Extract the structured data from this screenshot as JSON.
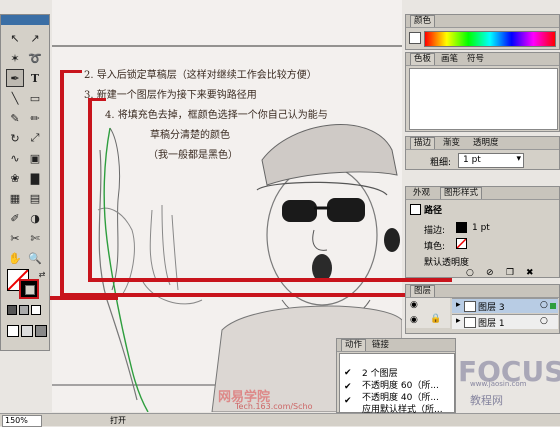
{
  "annotations": {
    "step2": "2. 导入后锁定草稿层（这样对继续工作会比较方便）",
    "step3": "3. 新建一个图层作为接下来要钩路径用",
    "step4_line1": "4. 将填充色去掉，框颜色选择一个你自己认为能与",
    "step4_line2": "草稿分清楚的颜色",
    "step4_line3": "（我一般都是黑色）"
  },
  "color_palette": {
    "title": "颜色"
  },
  "swatch_tabs": [
    "色板",
    "画笔",
    "符号"
  ],
  "stroke_tabs": [
    "描边",
    "渐变",
    "透明度"
  ],
  "stroke": {
    "weight_label": "粗细:",
    "weight_value": "1 pt"
  },
  "appearance_tabs": [
    "外观",
    "图形样式"
  ],
  "appearance": {
    "object": "路径",
    "stroke_label": "描边:",
    "stroke_value": "1 pt",
    "fill_label": "填色:",
    "opacity_label": "默认透明度"
  },
  "layers": {
    "tab": "图层",
    "rows": [
      {
        "name": "图层 3",
        "selected": true
      },
      {
        "name": "图层 1",
        "selected": false
      }
    ]
  },
  "actions": {
    "tabs": [
      "动作",
      "链接"
    ],
    "count_label": "2 个图层",
    "items": [
      "不透明度 60（所...",
      "不透明度 40（所...",
      "应用默认样式（所..."
    ]
  },
  "status": {
    "zoom": "150%",
    "label": "打开"
  },
  "watermarks": {
    "site_cn": "网易学院",
    "site_url": "Tech.163.com/Scho",
    "brand": "FOCUS",
    "site2_cn": "教程网",
    "site2_url": "www.jaosin.com"
  },
  "colors": {
    "annotation_red": "#c8141c",
    "path_green": "#2e9e3e",
    "titlebar": "#3a6ea5"
  }
}
